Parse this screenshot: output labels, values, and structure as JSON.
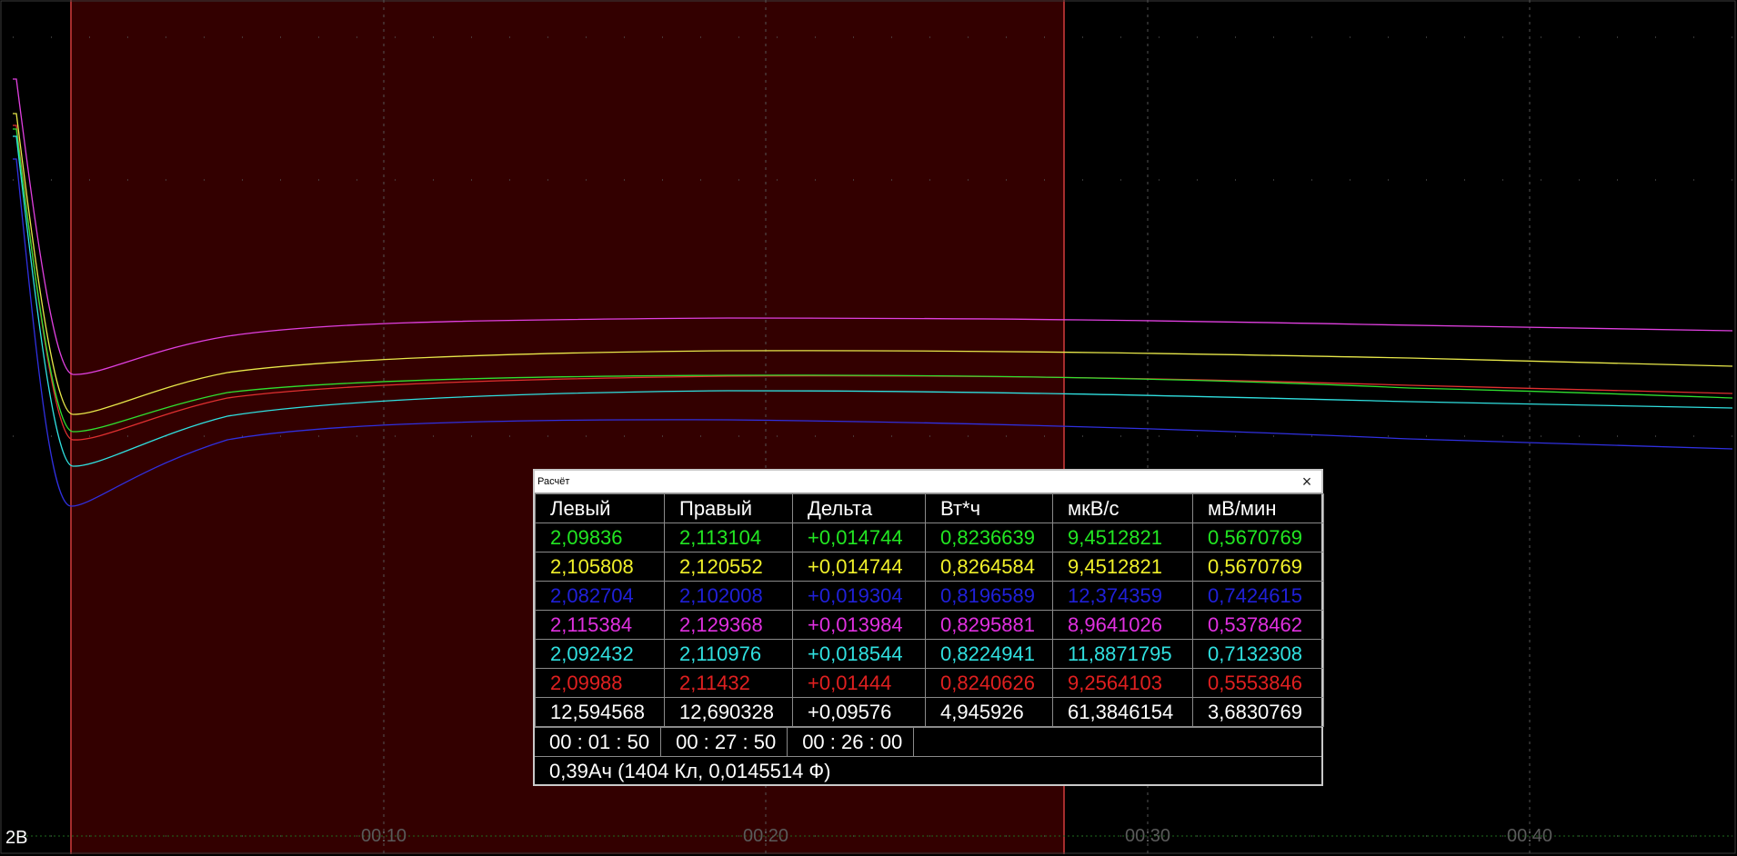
{
  "plot": {
    "y_label": "2В",
    "x_ticks": [
      "00:10",
      "00:20",
      "00:30",
      "00:40"
    ],
    "background_color": "#000000",
    "selection_color": "#330000",
    "selection_border_color": "#d23c3c",
    "series_colors": [
      "#e040e0",
      "#e8e84a",
      "#e03030",
      "#30e030",
      "#30e0e0",
      "#3030e0"
    ]
  },
  "dialog": {
    "title": "Расчёт",
    "close_icon": "close-icon",
    "headers": [
      "Левый",
      "Правый",
      "Дельта",
      "Вт*ч",
      "мкВ/с",
      "мВ/мин"
    ],
    "rows": [
      {
        "color": "#22e622",
        "cells": [
          "2,09836",
          "2,113104",
          "+0,014744",
          "0,8236639",
          "9,4512821",
          "0,5670769"
        ]
      },
      {
        "color": "#f0f02a",
        "cells": [
          "2,105808",
          "2,120552",
          "+0,014744",
          "0,8264584",
          "9,4512821",
          "0,5670769"
        ]
      },
      {
        "color": "#2020d8",
        "cells": [
          "2,082704",
          "2,102008",
          "+0,019304",
          "0,8196589",
          "12,374359",
          "0,7424615"
        ]
      },
      {
        "color": "#e030e0",
        "cells": [
          "2,115384",
          "2,129368",
          "+0,013984",
          "0,8295881",
          "8,9641026",
          "0,5378462"
        ]
      },
      {
        "color": "#30e0e0",
        "cells": [
          "2,092432",
          "2,110976",
          "+0,018544",
          "0,8224941",
          "11,8871795",
          "0,7132308"
        ]
      },
      {
        "color": "#e02020",
        "cells": [
          "2,09988",
          "2,11432",
          "+0,01444",
          "0,8240626",
          "9,2564103",
          "0,5553846"
        ]
      },
      {
        "color": "#ffffff",
        "cells": [
          "12,594568",
          "12,690328",
          "+0,09576",
          "4,945926",
          "61,3846154",
          "3,6830769"
        ]
      }
    ],
    "times": [
      "00 : 01 : 50",
      "00 : 27 : 50",
      "00 : 26 : 00"
    ],
    "summary": "0,39Ач (1404 Кл, 0,0145514 Ф)"
  }
}
